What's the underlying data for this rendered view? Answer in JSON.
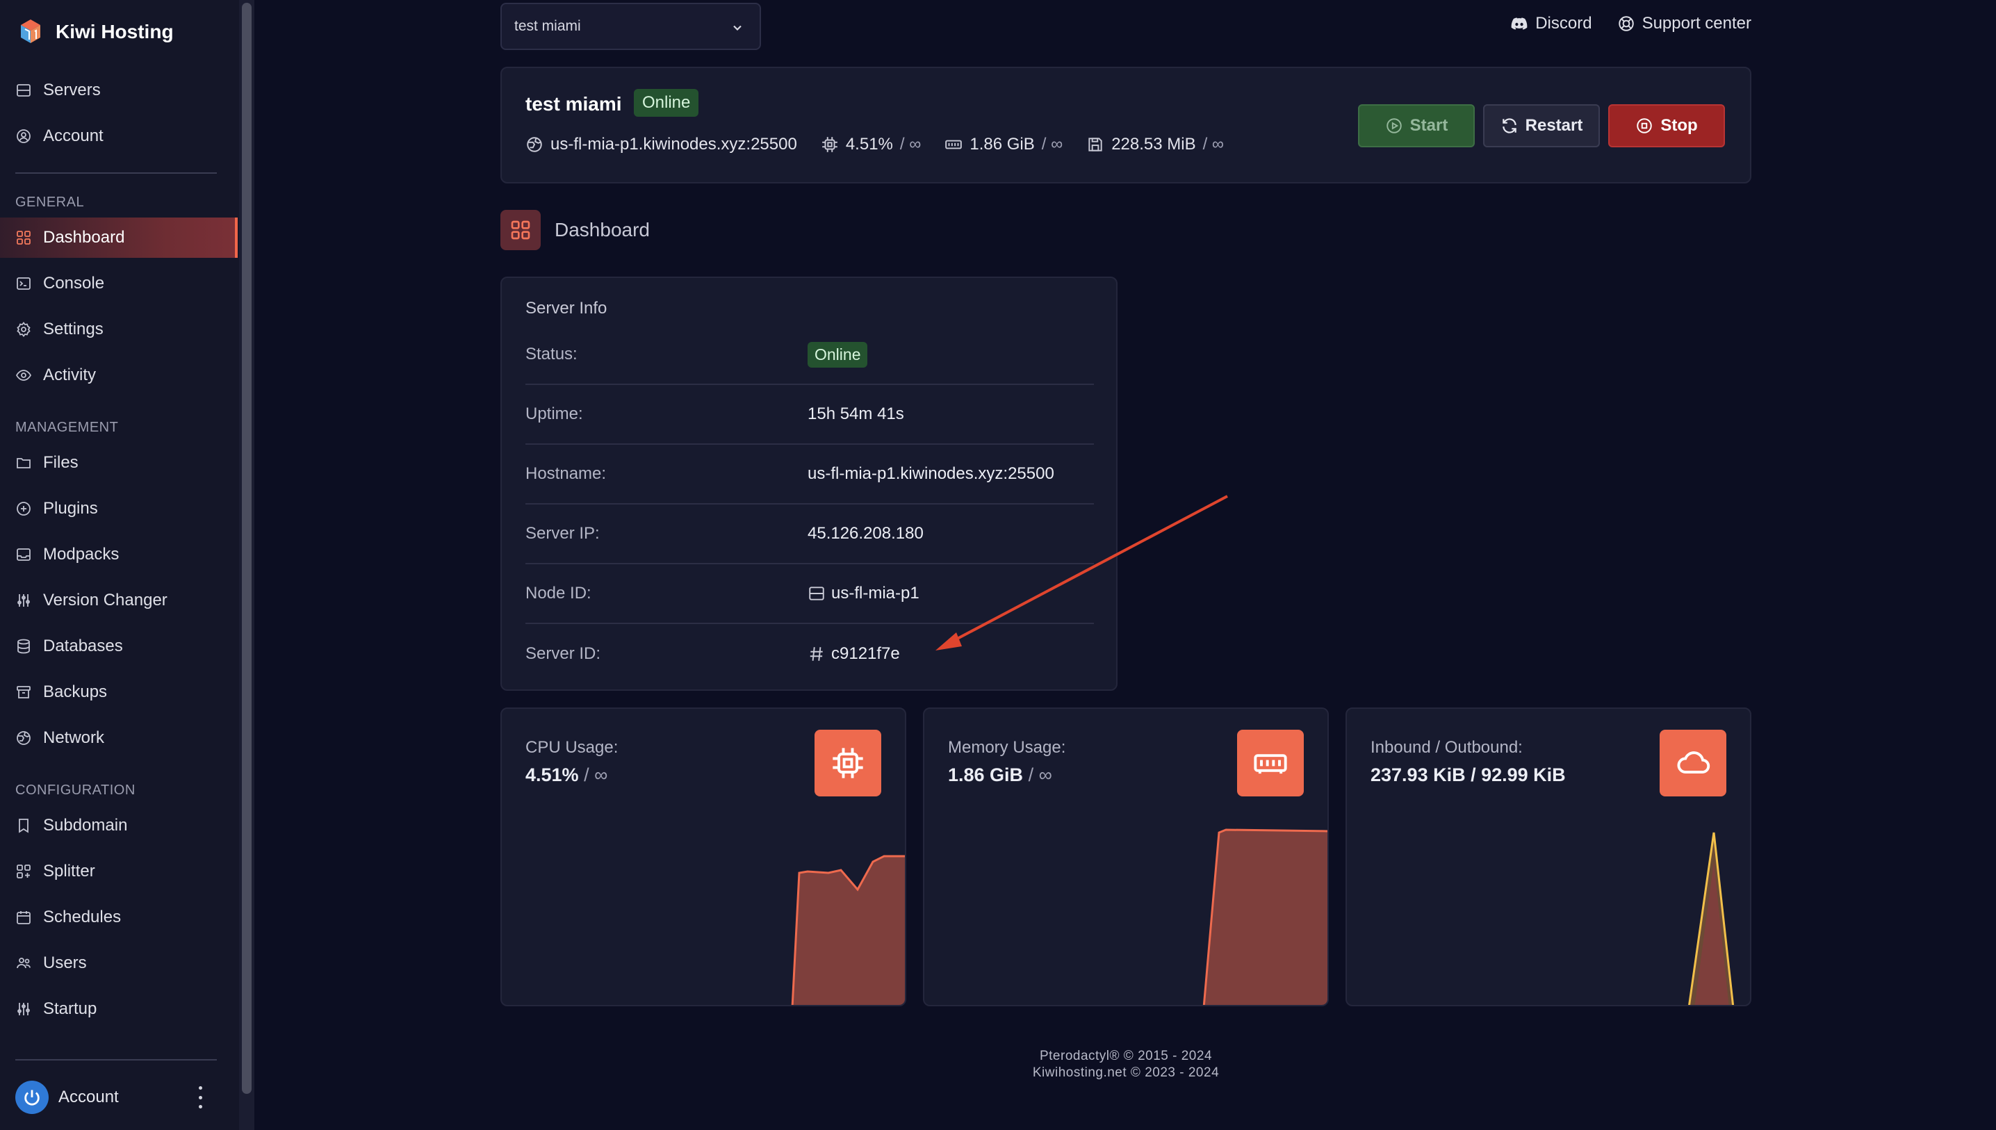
{
  "brand": {
    "name": "Kiwi Hosting"
  },
  "sidebar": {
    "top_items": [
      {
        "label": "Servers",
        "icon": "server-icon"
      },
      {
        "label": "Account",
        "icon": "user-circle-icon"
      }
    ],
    "sections": [
      {
        "label": "GENERAL"
      },
      {
        "label": "MANAGEMENT"
      },
      {
        "label": "CONFIGURATION"
      }
    ],
    "items": [
      {
        "label": "Dashboard",
        "icon": "grid-icon",
        "active": true
      },
      {
        "label": "Console",
        "icon": "terminal-icon"
      },
      {
        "label": "Settings",
        "icon": "gear-icon"
      },
      {
        "label": "Activity",
        "icon": "eye-icon"
      },
      {
        "label": "Files",
        "icon": "folder-icon"
      },
      {
        "label": "Plugins",
        "icon": "plus-circle-icon"
      },
      {
        "label": "Modpacks",
        "icon": "inbox-icon"
      },
      {
        "label": "Version Changer",
        "icon": "sliders-icon"
      },
      {
        "label": "Databases",
        "icon": "database-icon"
      },
      {
        "label": "Backups",
        "icon": "archive-icon"
      },
      {
        "label": "Network",
        "icon": "globe-icon"
      },
      {
        "label": "Subdomain",
        "icon": "bookmark-icon"
      },
      {
        "label": "Splitter",
        "icon": "grid-plus-icon"
      },
      {
        "label": "Schedules",
        "icon": "calendar-icon"
      },
      {
        "label": "Users",
        "icon": "users-icon"
      },
      {
        "label": "Startup",
        "icon": "sliders-icon"
      }
    ],
    "account_label": "Account"
  },
  "topbar": {
    "server_select": "test miami",
    "discord": "Discord",
    "support": "Support center"
  },
  "server": {
    "name": "test miami",
    "status": "Online",
    "address": "us-fl-mia-p1.kiwinodes.xyz:25500",
    "cpu": "4.51%",
    "cpu_limit": "/ ∞",
    "memory": "1.86 GiB",
    "memory_limit": "/ ∞",
    "disk": "228.53 MiB",
    "disk_limit": "/ ∞",
    "buttons": {
      "start": "Start",
      "restart": "Restart",
      "stop": "Stop"
    }
  },
  "page": {
    "title": "Dashboard"
  },
  "info": {
    "title": "Server Info",
    "rows": [
      {
        "label": "Status:",
        "value": "Online"
      },
      {
        "label": "Uptime:",
        "value": "15h 54m 41s"
      },
      {
        "label": "Hostname:",
        "value": "us-fl-mia-p1.kiwinodes.xyz:25500"
      },
      {
        "label": "Server IP:",
        "value": "45.126.208.180"
      },
      {
        "label": "Node ID:",
        "value": "us-fl-mia-p1"
      },
      {
        "label": "Server ID:",
        "value": "c9121f7e"
      }
    ]
  },
  "stats": {
    "cpu": {
      "label": "CPU Usage:",
      "value": "4.51%",
      "suffix": "/ ∞"
    },
    "memory": {
      "label": "Memory Usage:",
      "value": "1.86 GiB",
      "suffix": "/ ∞"
    },
    "network": {
      "label": "Inbound / Outbound:",
      "value": "237.93 KiB / 92.99 KiB"
    }
  },
  "footer": {
    "line1": "Pterodactyl® © 2015 - 2024",
    "line2": "Kiwihosting.net © 2023 - 2024"
  },
  "colors": {
    "accent": "#ee6a4e",
    "online": "#24522f",
    "stop": "#9c2424",
    "start": "#2c5a33",
    "chart_fill": "#8a4440",
    "network_line": "#f2c04a"
  }
}
